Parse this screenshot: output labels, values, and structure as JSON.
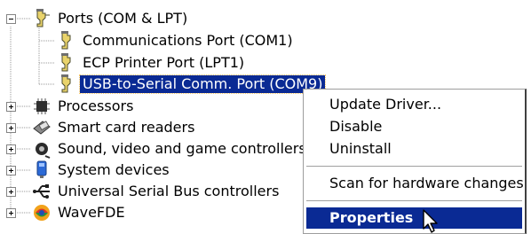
{
  "tree": {
    "ports": {
      "label": "Ports (COM & LPT)",
      "icon": "port-connector-icon",
      "children": [
        {
          "label": "Communications Port (COM1)",
          "icon": "port-connector-icon"
        },
        {
          "label": "ECP Printer Port (LPT1)",
          "icon": "port-connector-icon"
        },
        {
          "label": "USB-to-Serial Comm. Port (COM9)",
          "icon": "port-connector-icon",
          "selected": true
        }
      ]
    },
    "categories": [
      {
        "label": "Processors",
        "icon": "processor-chip-icon"
      },
      {
        "label": "Smart card readers",
        "icon": "smart-card-reader-icon"
      },
      {
        "label": "Sound, video and game controllers",
        "icon": "speaker-icon"
      },
      {
        "label": "System devices",
        "icon": "computer-system-icon"
      },
      {
        "label": "Universal Serial Bus controllers",
        "icon": "usb-icon"
      },
      {
        "label": "WaveFDE",
        "icon": "wavefde-icon"
      }
    ]
  },
  "context_menu": {
    "items": [
      {
        "label": "Update Driver..."
      },
      {
        "label": "Disable"
      },
      {
        "label": "Uninstall"
      },
      {
        "label": "Scan for hardware changes"
      },
      {
        "label": "Properties",
        "bold": true,
        "highlighted": true
      }
    ]
  },
  "colors": {
    "selection": "#0a2a94",
    "tree_line": "#9a9a9a"
  }
}
